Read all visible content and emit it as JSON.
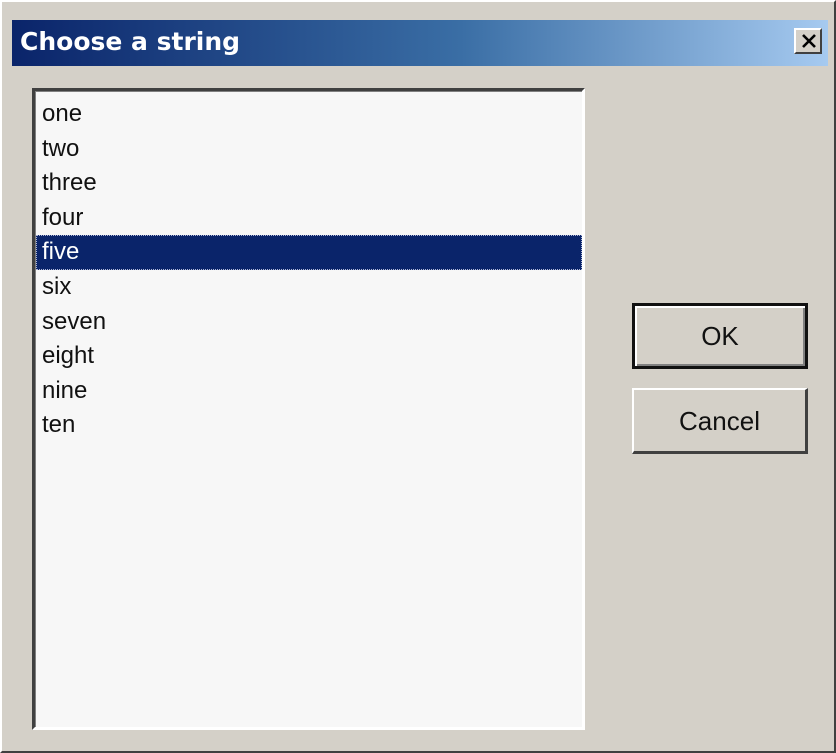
{
  "dialog": {
    "title": "Choose a string",
    "close_icon": "close-x-icon"
  },
  "listbox": {
    "items": [
      {
        "label": "one",
        "selected": false
      },
      {
        "label": "two",
        "selected": false
      },
      {
        "label": "three",
        "selected": false
      },
      {
        "label": "four",
        "selected": false
      },
      {
        "label": "five",
        "selected": true
      },
      {
        "label": "six",
        "selected": false
      },
      {
        "label": "seven",
        "selected": false
      },
      {
        "label": "eight",
        "selected": false
      },
      {
        "label": "nine",
        "selected": false
      },
      {
        "label": "ten",
        "selected": false
      }
    ]
  },
  "buttons": {
    "ok_label": "OK",
    "cancel_label": "Cancel"
  },
  "colors": {
    "titlebar_start": "#0a246a",
    "titlebar_end": "#a6caf0",
    "selection": "#0a246a",
    "face": "#d4d0c8"
  }
}
